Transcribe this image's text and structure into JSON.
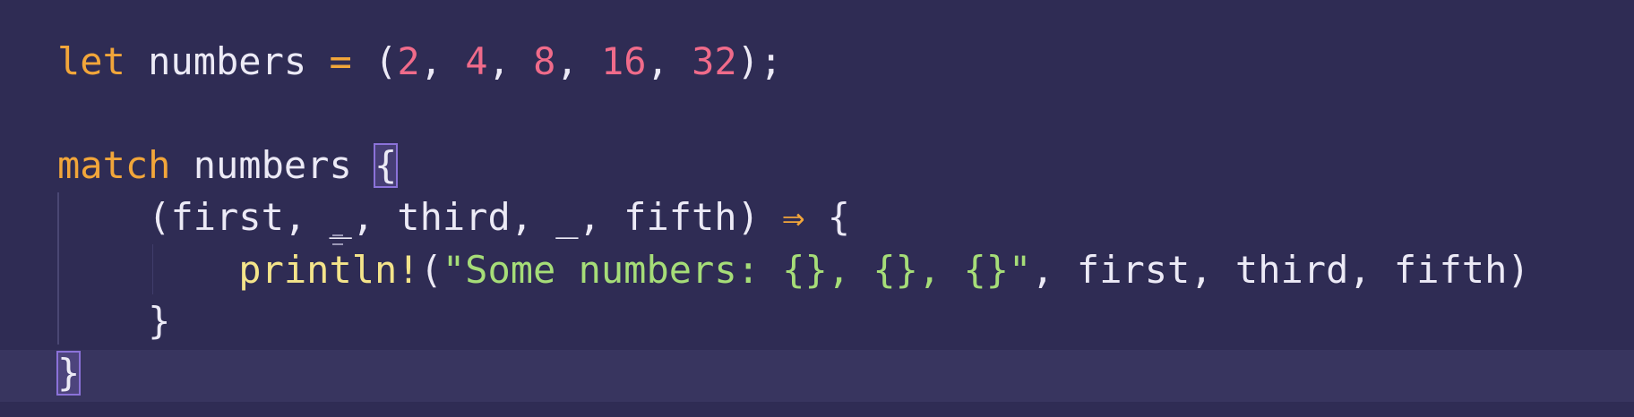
{
  "colors": {
    "background": "#2f2c54",
    "current_line": "#38355f",
    "keyword": "#f2a63a",
    "number": "#f06b8a",
    "string": "#a6dd78",
    "macro": "#f4e48a",
    "text": "#eceaf6",
    "bracket_highlight": "#8b72d9"
  },
  "code": {
    "line1": {
      "kw_let": "let",
      "var": " numbers ",
      "eq": "=",
      "open": " (",
      "n1": "2",
      "c1": ", ",
      "n2": "4",
      "c2": ", ",
      "n3": "8",
      "c3": ", ",
      "n4": "16",
      "c4": ", ",
      "n5": "32",
      "close": ");"
    },
    "line2": {
      "kw_match": "match",
      "var": " numbers ",
      "brace": "{"
    },
    "line3": {
      "indent": "    ",
      "pattern": "(first, _, third, _, fifth) ",
      "arrow": "⇒",
      "brace": " {"
    },
    "line4": {
      "indent": "        ",
      "macro": "println!",
      "open": "(",
      "string": "\"Some numbers: {}, {}, {}\"",
      "args": ", first, third, fifth)"
    },
    "line5": {
      "indent": "    ",
      "brace": "}"
    },
    "line6": {
      "brace": "}"
    }
  }
}
